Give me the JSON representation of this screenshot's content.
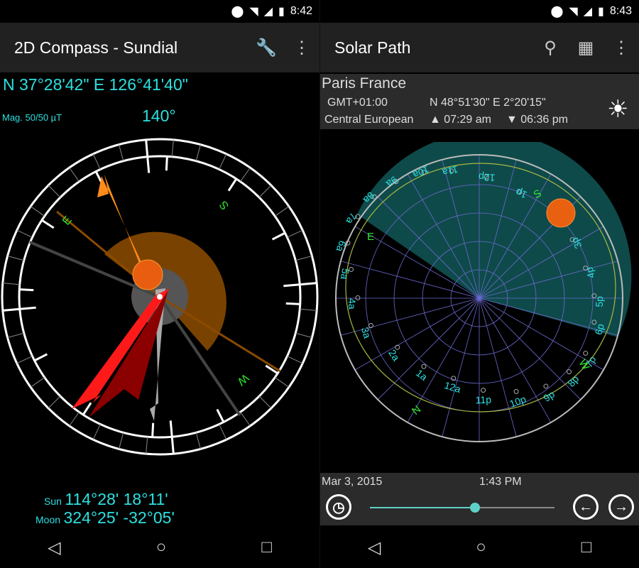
{
  "left": {
    "status": {
      "time": "8:42"
    },
    "app_title": "2D Compass - Sundial",
    "coords": "N 37°28'42\" E 126°41'40\"",
    "mag": "Mag. 50/50 µT",
    "heading": "140°",
    "directions": {
      "S": "S",
      "E": "E",
      "W": "W",
      "N": "N"
    },
    "sun_label": "Sun",
    "sun_value": "114°28' 18°11'",
    "moon_label": "Moon",
    "moon_value": "324°25' -32°05'",
    "icons": [
      "wrench-icon",
      "overflow-menu-icon"
    ]
  },
  "right": {
    "status": {
      "time": "8:43"
    },
    "app_title": "Solar Path",
    "location": "Paris France",
    "gmt": "GMT+01:00",
    "timezone": "Central European",
    "coords": "N 48°51'30\" E 2°20'15\"",
    "sunrise": "▲ 07:29 am",
    "sunset": "▼ 06:36 pm",
    "hours": [
      "8a",
      "9a",
      "10a",
      "11a",
      "12p",
      "1p",
      "2p",
      "3p",
      "4p",
      "5p",
      "6p",
      "7p",
      "8p",
      "9p",
      "10p",
      "11p",
      "12a",
      "1a",
      "2a",
      "3a",
      "4a",
      "5a",
      "6a",
      "7a"
    ],
    "directions": {
      "S": "S",
      "E": "E",
      "W": "W",
      "N": "N"
    },
    "date": "Mar 3, 2015",
    "time": "1:43 PM",
    "slider_fraction": 0.57,
    "icons": [
      "search-icon",
      "calendar-grid-icon",
      "overflow-menu-icon",
      "sun-icon",
      "clock-icon",
      "arrow-left-icon",
      "arrow-right-icon"
    ]
  },
  "colors": {
    "cyan": "#2de0e0",
    "accent_green": "#2ee62e",
    "sun_orange": "#ff8c1a",
    "needle_red": "#ff1a1a"
  }
}
